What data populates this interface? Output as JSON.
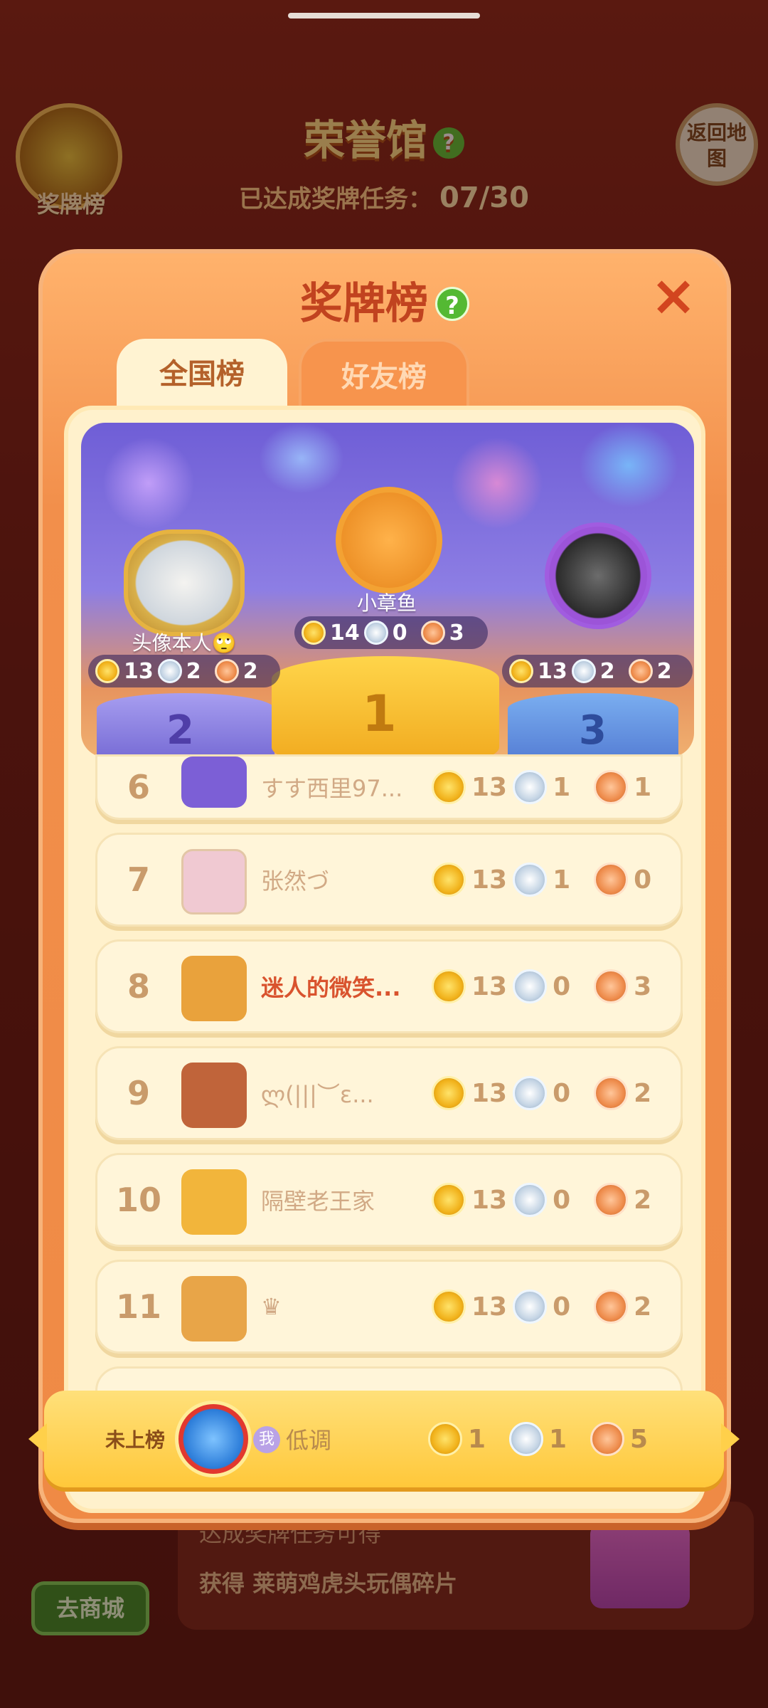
{
  "background": {
    "title": "荣誉馆",
    "progress_label": "已达成奖牌任务：",
    "progress_value": "07/30",
    "medal_button_label": "奖牌榜",
    "back_button_label": "返回地图",
    "bottom_line1": "达成奖牌任务可得",
    "bottom_line2": "获得 莱萌鸡虎头玩偶碎片",
    "shop_button_label": "去商城"
  },
  "modal": {
    "title": "奖牌榜",
    "help_icon": "?",
    "close_icon": "×",
    "tabs": [
      {
        "label": "全国榜",
        "active": true
      },
      {
        "label": "好友榜",
        "active": false
      }
    ]
  },
  "podium": [
    {
      "rank": "2",
      "name": "头像本人🙄",
      "gold": "13",
      "silver": "2",
      "bronze": "2"
    },
    {
      "rank": "1",
      "name": "小章鱼",
      "gold": "14",
      "silver": "0",
      "bronze": "3"
    },
    {
      "rank": "3",
      "name": "",
      "gold": "13",
      "silver": "2",
      "bronze": "2"
    }
  ],
  "rows": [
    {
      "rank": "6",
      "name": "すす西里97...",
      "gold": "13",
      "silver": "1",
      "bronze": "1",
      "avatar_color": "#7c5fd6"
    },
    {
      "rank": "7",
      "name": "张然づ",
      "gold": "13",
      "silver": "1",
      "bronze": "0",
      "avatar_color": "#f0c9d2"
    },
    {
      "rank": "8",
      "name": "迷人的微笑...",
      "gold": "13",
      "silver": "0",
      "bronze": "3",
      "avatar_color": "#e9a23c"
    },
    {
      "rank": "9",
      "name": "ლ(|||︶ε...",
      "gold": "13",
      "silver": "0",
      "bronze": "2",
      "avatar_color": "#c0643a"
    },
    {
      "rank": "10",
      "name": "隔壁老王家",
      "gold": "13",
      "silver": "0",
      "bronze": "2",
      "avatar_color": "#f2b53b"
    },
    {
      "rank": "11",
      "name": "♛",
      "gold": "13",
      "silver": "0",
      "bronze": "2",
      "avatar_color": "#e8a548"
    }
  ],
  "me": {
    "status": "未上榜",
    "badge": "我",
    "name": "低调",
    "gold": "1",
    "silver": "1",
    "bronze": "5"
  }
}
